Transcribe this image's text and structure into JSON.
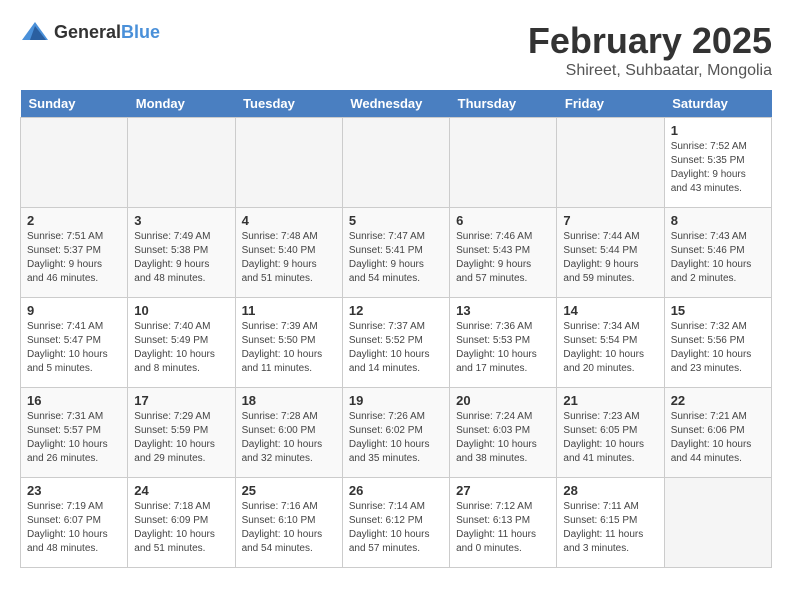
{
  "header": {
    "logo_general": "General",
    "logo_blue": "Blue",
    "title": "February 2025",
    "subtitle": "Shireet, Suhbaatar, Mongolia"
  },
  "days_of_week": [
    "Sunday",
    "Monday",
    "Tuesday",
    "Wednesday",
    "Thursday",
    "Friday",
    "Saturday"
  ],
  "weeks": [
    {
      "days": [
        {
          "num": "",
          "info": "",
          "empty": true
        },
        {
          "num": "",
          "info": "",
          "empty": true
        },
        {
          "num": "",
          "info": "",
          "empty": true
        },
        {
          "num": "",
          "info": "",
          "empty": true
        },
        {
          "num": "",
          "info": "",
          "empty": true
        },
        {
          "num": "",
          "info": "",
          "empty": true
        },
        {
          "num": "1",
          "info": "Sunrise: 7:52 AM\nSunset: 5:35 PM\nDaylight: 9 hours and 43 minutes.",
          "empty": false
        }
      ]
    },
    {
      "days": [
        {
          "num": "2",
          "info": "Sunrise: 7:51 AM\nSunset: 5:37 PM\nDaylight: 9 hours and 46 minutes.",
          "empty": false
        },
        {
          "num": "3",
          "info": "Sunrise: 7:49 AM\nSunset: 5:38 PM\nDaylight: 9 hours and 48 minutes.",
          "empty": false
        },
        {
          "num": "4",
          "info": "Sunrise: 7:48 AM\nSunset: 5:40 PM\nDaylight: 9 hours and 51 minutes.",
          "empty": false
        },
        {
          "num": "5",
          "info": "Sunrise: 7:47 AM\nSunset: 5:41 PM\nDaylight: 9 hours and 54 minutes.",
          "empty": false
        },
        {
          "num": "6",
          "info": "Sunrise: 7:46 AM\nSunset: 5:43 PM\nDaylight: 9 hours and 57 minutes.",
          "empty": false
        },
        {
          "num": "7",
          "info": "Sunrise: 7:44 AM\nSunset: 5:44 PM\nDaylight: 9 hours and 59 minutes.",
          "empty": false
        },
        {
          "num": "8",
          "info": "Sunrise: 7:43 AM\nSunset: 5:46 PM\nDaylight: 10 hours and 2 minutes.",
          "empty": false
        }
      ]
    },
    {
      "days": [
        {
          "num": "9",
          "info": "Sunrise: 7:41 AM\nSunset: 5:47 PM\nDaylight: 10 hours and 5 minutes.",
          "empty": false
        },
        {
          "num": "10",
          "info": "Sunrise: 7:40 AM\nSunset: 5:49 PM\nDaylight: 10 hours and 8 minutes.",
          "empty": false
        },
        {
          "num": "11",
          "info": "Sunrise: 7:39 AM\nSunset: 5:50 PM\nDaylight: 10 hours and 11 minutes.",
          "empty": false
        },
        {
          "num": "12",
          "info": "Sunrise: 7:37 AM\nSunset: 5:52 PM\nDaylight: 10 hours and 14 minutes.",
          "empty": false
        },
        {
          "num": "13",
          "info": "Sunrise: 7:36 AM\nSunset: 5:53 PM\nDaylight: 10 hours and 17 minutes.",
          "empty": false
        },
        {
          "num": "14",
          "info": "Sunrise: 7:34 AM\nSunset: 5:54 PM\nDaylight: 10 hours and 20 minutes.",
          "empty": false
        },
        {
          "num": "15",
          "info": "Sunrise: 7:32 AM\nSunset: 5:56 PM\nDaylight: 10 hours and 23 minutes.",
          "empty": false
        }
      ]
    },
    {
      "days": [
        {
          "num": "16",
          "info": "Sunrise: 7:31 AM\nSunset: 5:57 PM\nDaylight: 10 hours and 26 minutes.",
          "empty": false
        },
        {
          "num": "17",
          "info": "Sunrise: 7:29 AM\nSunset: 5:59 PM\nDaylight: 10 hours and 29 minutes.",
          "empty": false
        },
        {
          "num": "18",
          "info": "Sunrise: 7:28 AM\nSunset: 6:00 PM\nDaylight: 10 hours and 32 minutes.",
          "empty": false
        },
        {
          "num": "19",
          "info": "Sunrise: 7:26 AM\nSunset: 6:02 PM\nDaylight: 10 hours and 35 minutes.",
          "empty": false
        },
        {
          "num": "20",
          "info": "Sunrise: 7:24 AM\nSunset: 6:03 PM\nDaylight: 10 hours and 38 minutes.",
          "empty": false
        },
        {
          "num": "21",
          "info": "Sunrise: 7:23 AM\nSunset: 6:05 PM\nDaylight: 10 hours and 41 minutes.",
          "empty": false
        },
        {
          "num": "22",
          "info": "Sunrise: 7:21 AM\nSunset: 6:06 PM\nDaylight: 10 hours and 44 minutes.",
          "empty": false
        }
      ]
    },
    {
      "days": [
        {
          "num": "23",
          "info": "Sunrise: 7:19 AM\nSunset: 6:07 PM\nDaylight: 10 hours and 48 minutes.",
          "empty": false
        },
        {
          "num": "24",
          "info": "Sunrise: 7:18 AM\nSunset: 6:09 PM\nDaylight: 10 hours and 51 minutes.",
          "empty": false
        },
        {
          "num": "25",
          "info": "Sunrise: 7:16 AM\nSunset: 6:10 PM\nDaylight: 10 hours and 54 minutes.",
          "empty": false
        },
        {
          "num": "26",
          "info": "Sunrise: 7:14 AM\nSunset: 6:12 PM\nDaylight: 10 hours and 57 minutes.",
          "empty": false
        },
        {
          "num": "27",
          "info": "Sunrise: 7:12 AM\nSunset: 6:13 PM\nDaylight: 11 hours and 0 minutes.",
          "empty": false
        },
        {
          "num": "28",
          "info": "Sunrise: 7:11 AM\nSunset: 6:15 PM\nDaylight: 11 hours and 3 minutes.",
          "empty": false
        },
        {
          "num": "",
          "info": "",
          "empty": true
        }
      ]
    }
  ]
}
